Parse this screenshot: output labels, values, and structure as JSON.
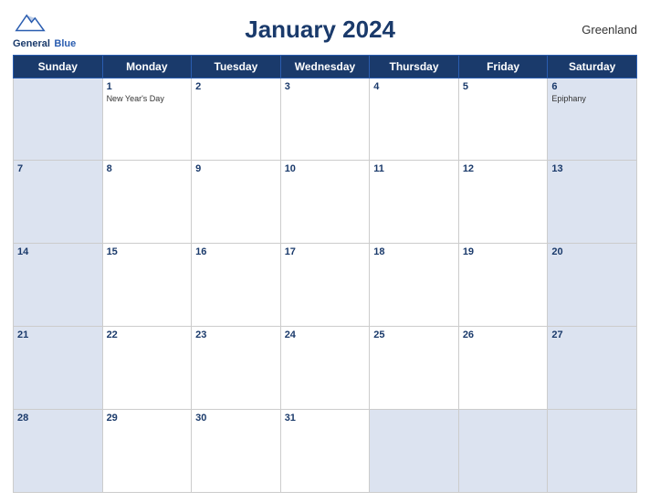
{
  "header": {
    "logo_line1": "General",
    "logo_line2": "Blue",
    "title": "January 2024",
    "country": "Greenland"
  },
  "days_of_week": [
    "Sunday",
    "Monday",
    "Tuesday",
    "Wednesday",
    "Thursday",
    "Friday",
    "Saturday"
  ],
  "weeks": [
    [
      {
        "day": "",
        "holiday": "",
        "weekend": true
      },
      {
        "day": "1",
        "holiday": "New Year's Day",
        "weekend": false
      },
      {
        "day": "2",
        "holiday": "",
        "weekend": false
      },
      {
        "day": "3",
        "holiday": "",
        "weekend": false
      },
      {
        "day": "4",
        "holiday": "",
        "weekend": false
      },
      {
        "day": "5",
        "holiday": "",
        "weekend": false
      },
      {
        "day": "6",
        "holiday": "Epiphany",
        "weekend": true
      }
    ],
    [
      {
        "day": "7",
        "holiday": "",
        "weekend": true
      },
      {
        "day": "8",
        "holiday": "",
        "weekend": false
      },
      {
        "day": "9",
        "holiday": "",
        "weekend": false
      },
      {
        "day": "10",
        "holiday": "",
        "weekend": false
      },
      {
        "day": "11",
        "holiday": "",
        "weekend": false
      },
      {
        "day": "12",
        "holiday": "",
        "weekend": false
      },
      {
        "day": "13",
        "holiday": "",
        "weekend": true
      }
    ],
    [
      {
        "day": "14",
        "holiday": "",
        "weekend": true
      },
      {
        "day": "15",
        "holiday": "",
        "weekend": false
      },
      {
        "day": "16",
        "holiday": "",
        "weekend": false
      },
      {
        "day": "17",
        "holiday": "",
        "weekend": false
      },
      {
        "day": "18",
        "holiday": "",
        "weekend": false
      },
      {
        "day": "19",
        "holiday": "",
        "weekend": false
      },
      {
        "day": "20",
        "holiday": "",
        "weekend": true
      }
    ],
    [
      {
        "day": "21",
        "holiday": "",
        "weekend": true
      },
      {
        "day": "22",
        "holiday": "",
        "weekend": false
      },
      {
        "day": "23",
        "holiday": "",
        "weekend": false
      },
      {
        "day": "24",
        "holiday": "",
        "weekend": false
      },
      {
        "day": "25",
        "holiday": "",
        "weekend": false
      },
      {
        "day": "26",
        "holiday": "",
        "weekend": false
      },
      {
        "day": "27",
        "holiday": "",
        "weekend": true
      }
    ],
    [
      {
        "day": "28",
        "holiday": "",
        "weekend": true
      },
      {
        "day": "29",
        "holiday": "",
        "weekend": false
      },
      {
        "day": "30",
        "holiday": "",
        "weekend": false
      },
      {
        "day": "31",
        "holiday": "",
        "weekend": false
      },
      {
        "day": "",
        "holiday": "",
        "weekend": false
      },
      {
        "day": "",
        "holiday": "",
        "weekend": false
      },
      {
        "day": "",
        "holiday": "",
        "weekend": true
      }
    ]
  ],
  "colors": {
    "header_bg": "#1a3a6b",
    "weekend_bg": "#dce3f0",
    "weekday_bg": "#ffffff",
    "title_color": "#1a3a6b"
  }
}
